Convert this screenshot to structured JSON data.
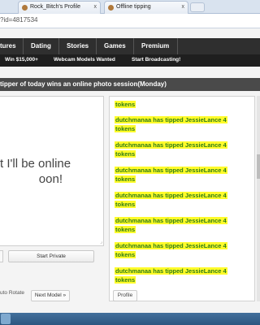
{
  "browser": {
    "tabs": [
      {
        "label": "Rock_Bitch's Profile",
        "close": "x"
      },
      {
        "label": "Offline tipping",
        "close": "x"
      }
    ],
    "address": "?id=4817534"
  },
  "nav": {
    "items": [
      "tures",
      "Dating",
      "Stories",
      "Games",
      "Premium"
    ]
  },
  "subnav": {
    "items": [
      "Win $15,000+",
      "Webcam Models Wanted",
      "Start Broadcasting!"
    ]
  },
  "title": "tipper of today wins an online photo session(Monday)",
  "video": {
    "offline_line1": "t I'll be online",
    "offline_line2": "oon!",
    "resize_glyph": "⌟"
  },
  "buttons": {
    "start_private": "Start Private",
    "auto_rotate": "uto Rotate",
    "next_model": "Next Model »",
    "profile": "Profile"
  },
  "chat": {
    "first_fragment": "tokens",
    "messages": [
      {
        "line1": "dutchmanaa has tipped JessieLance 4",
        "line2": "tokens"
      },
      {
        "line1": "dutchmanaa has tipped JessieLance 4",
        "line2": "tokens"
      },
      {
        "line1": "dutchmanaa has tipped JessieLance 4",
        "line2": "tokens"
      },
      {
        "line1": "dutchmanaa has tipped JessieLance 4",
        "line2": "tokens"
      },
      {
        "line1": "dutchmanaa has tipped JessieLance 4",
        "line2": "tokens"
      },
      {
        "line1": "dutchmanaa has tipped JessieLance 4",
        "line2": "tokens"
      },
      {
        "line1": "dutchmanaa has tipped JessieLance 4",
        "line2": "tokens"
      }
    ]
  },
  "colors": {
    "highlight": "#fffb2a",
    "chat_text": "#2e7d16",
    "nav_bg": "#2f2f2f"
  }
}
